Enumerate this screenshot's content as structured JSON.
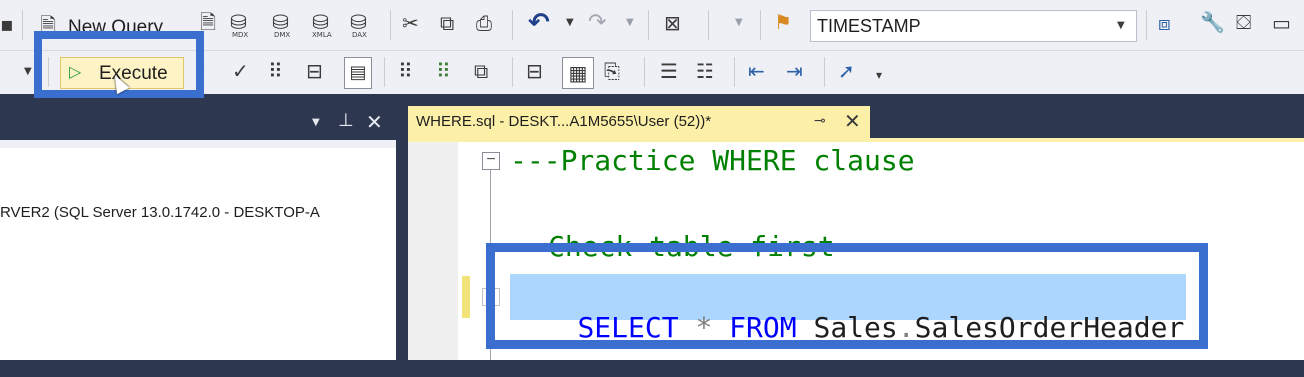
{
  "toolbar": {
    "new_query_label": "New Query",
    "execute_label": "Execute",
    "search_combo_value": "TIMESTAMP",
    "icons": [
      "db-icon",
      "new-query-icon",
      "mdx-icon",
      "dmx-icon",
      "xmla-icon",
      "dax-icon",
      "cut-icon",
      "copy-icon",
      "paste-icon",
      "undo-icon",
      "redo-icon",
      "solution-icon",
      "find-icon",
      "search-combo",
      "properties-icon",
      "wrench-icon",
      "toolbox-icon",
      "window-icon",
      "execute-icon",
      "parse-icon",
      "results-icon",
      "display-plan-icon",
      "comment-icon",
      "uncomment-icon",
      "indent-icon",
      "outdent-icon",
      "specify-values-icon"
    ],
    "mdx_label": "MDX",
    "dmx_label": "DMX",
    "xmla_label": "XMLA",
    "dax_label": "DAX"
  },
  "object_explorer": {
    "server_node": "RVER2 (SQL Server 13.0.1742.0 - DESKTOP-A"
  },
  "editor_tab": {
    "title": "WHERE.sql - DESKT...A1M5655\\User (52))*"
  },
  "editor": {
    "line1": "---Practice WHERE clause",
    "line2": "Check table first",
    "line3_select": "SELECT",
    "line3_star": "*",
    "line3_from": "FROM",
    "line3_schema": "Sales",
    "line3_dot": ".",
    "line3_table": "SalesOrderHeader"
  },
  "colors": {
    "highlight_box": "#3a6fd0",
    "keyword": "#0000ff",
    "comment": "#008000",
    "selection": "#add6ff",
    "tab_active": "#fcf0a8"
  }
}
